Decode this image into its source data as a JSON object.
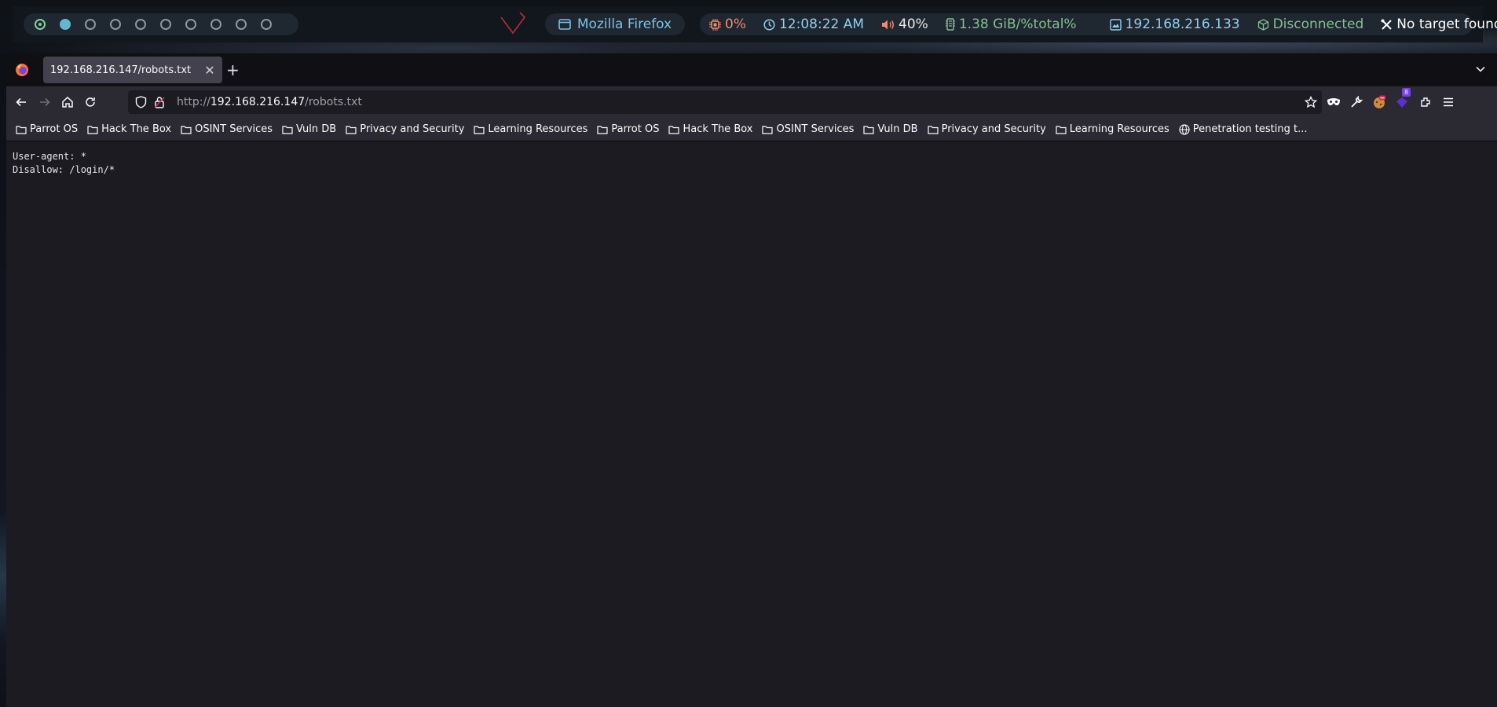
{
  "topbar": {
    "workspaces": [
      {
        "state": "current"
      },
      {
        "state": "active"
      },
      {
        "state": "empty"
      },
      {
        "state": "empty"
      },
      {
        "state": "empty"
      },
      {
        "state": "empty"
      },
      {
        "state": "empty"
      },
      {
        "state": "empty"
      },
      {
        "state": "empty"
      },
      {
        "state": "empty"
      }
    ],
    "window_title": "Mozilla Firefox",
    "cpu": "0%",
    "time": "12:08:22 AM",
    "volume": "40%",
    "memory": "1.38 GiB/%total%",
    "ip": "192.168.216.133",
    "vpn_status": "Disconnected",
    "target": "No target found!",
    "colors": {
      "cpu": "#f28a6d",
      "time": "#8fd0f0",
      "memory": "#84c08e",
      "separator": "#e0556b"
    }
  },
  "browser": {
    "tab": {
      "title": "192.168.216.147/robots.txt"
    },
    "url": {
      "scheme": "http://",
      "host": "192.168.216.147",
      "path": "/robots.txt"
    },
    "extension_badge": "8",
    "bookmarks": [
      {
        "label": "Parrot OS",
        "icon": "folder-icon"
      },
      {
        "label": "Hack The Box",
        "icon": "folder-icon"
      },
      {
        "label": "OSINT Services",
        "icon": "folder-icon"
      },
      {
        "label": "Vuln DB",
        "icon": "folder-icon"
      },
      {
        "label": "Privacy and Security",
        "icon": "folder-icon"
      },
      {
        "label": "Learning Resources",
        "icon": "folder-icon"
      },
      {
        "label": "Parrot OS",
        "icon": "folder-icon"
      },
      {
        "label": "Hack The Box",
        "icon": "folder-icon"
      },
      {
        "label": "OSINT Services",
        "icon": "folder-icon"
      },
      {
        "label": "Vuln DB",
        "icon": "folder-icon"
      },
      {
        "label": "Privacy and Security",
        "icon": "folder-icon"
      },
      {
        "label": "Learning Resources",
        "icon": "folder-icon"
      },
      {
        "label": "Penetration testing t...",
        "icon": "globe-icon"
      }
    ]
  },
  "page": {
    "lines": [
      "User-agent: *",
      "Disallow: /login/*"
    ]
  }
}
